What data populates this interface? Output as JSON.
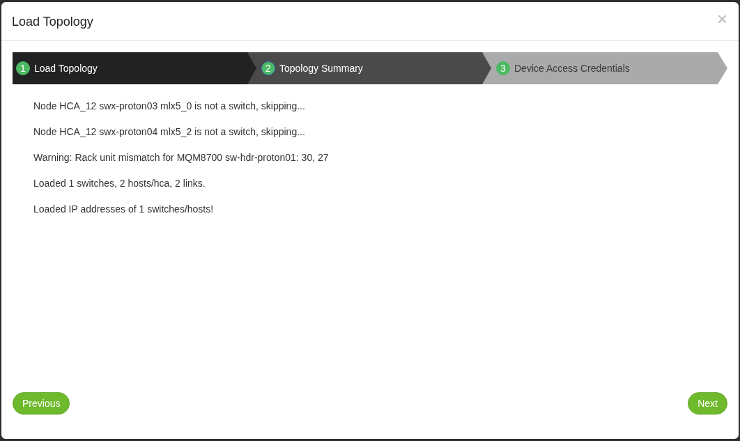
{
  "dialog": {
    "title": "Load Topology"
  },
  "steps": [
    {
      "number": "1",
      "label": "Load Topology",
      "selected": true,
      "disabled": false,
      "focused": false
    },
    {
      "number": "2",
      "label": "Topology Summary",
      "selected": false,
      "disabled": false,
      "focused": true
    },
    {
      "number": "3",
      "label": "Device Access Credentials",
      "selected": false,
      "disabled": true,
      "focused": false
    }
  ],
  "messages": [
    "Node HCA_12 swx-proton03 mlx5_0 is not a switch, skipping...",
    "Node HCA_12 swx-proton04 mlx5_2 is not a switch, skipping...",
    "Warning: Rack unit mismatch for MQM8700 sw-hdr-proton01: 30, 27",
    "Loaded 1 switches, 2 hosts/hca, 2 links.",
    "Loaded IP addresses of 1 switches/hosts!"
  ],
  "footer": {
    "previous": "Previous",
    "next": "Next"
  }
}
